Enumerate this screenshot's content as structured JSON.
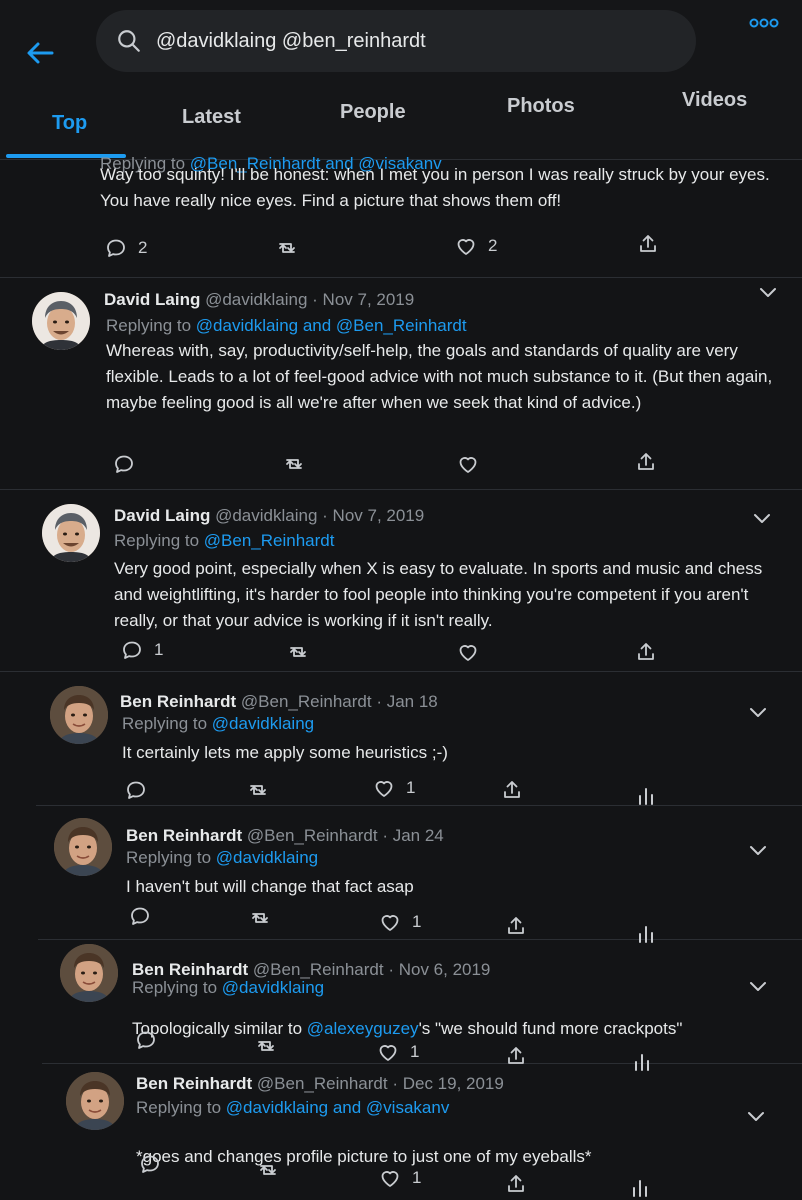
{
  "search": {
    "query": "@davidklaing @ben_reinhardt"
  },
  "tabs": [
    {
      "label": "Top"
    },
    {
      "label": "Latest"
    },
    {
      "label": "People"
    },
    {
      "label": "Photos"
    },
    {
      "label": "Videos"
    }
  ],
  "tweets": [
    {
      "name": "",
      "handle": "",
      "date": "",
      "reply_prefix": "Replying to",
      "reply_to": "@Ben_Reinhardt and @visakanv",
      "text": "Way too squinty! I'll be honest: when I met you in person I was really struck by your eyes. You have really nice eyes. Find a picture that shows them off!",
      "replies": "2",
      "retweets": "",
      "likes": "2"
    },
    {
      "name": "David Laing",
      "handle": "@davidklaing",
      "date": "· Nov 7, 2019",
      "reply_prefix": "Replying to",
      "reply_to": "@davidklaing and @Ben_Reinhardt",
      "text": "Whereas with, say, productivity/self-help, the goals and standards of quality are very flexible. Leads to a lot of feel-good advice with not much substance to it. (But then again, maybe feeling good is all we're after when we seek that kind of advice.)",
      "replies": "",
      "retweets": "",
      "likes": ""
    },
    {
      "name": "David Laing",
      "handle": "@davidklaing",
      "date": "· Nov 7, 2019",
      "reply_prefix": "Replying to",
      "reply_to": "@Ben_Reinhardt",
      "text": "Very good point, especially when X is easy to evaluate. In sports and music and chess and weightlifting, it's harder to fool people into thinking you're competent if you aren't really, or that your advice is working if it isn't really.",
      "replies": "1",
      "retweets": "",
      "likes": ""
    },
    {
      "name": "Ben Reinhardt",
      "handle": "@Ben_Reinhardt",
      "date": "· Jan 18",
      "reply_prefix": "Replying to",
      "reply_to": "@davidklaing",
      "text": "It certainly lets me apply some heuristics ;-)",
      "replies": "",
      "retweets": "",
      "likes": "1"
    },
    {
      "name": "Ben Reinhardt",
      "handle": "@Ben_Reinhardt",
      "date": "· Jan 24",
      "reply_prefix": "Replying to",
      "reply_to": "@davidklaing",
      "text": "I haven't but will change that fact asap",
      "replies": "",
      "retweets": "",
      "likes": "1"
    },
    {
      "name": "Ben Reinhardt",
      "handle": "@Ben_Reinhardt",
      "date": "· Nov 6, 2019",
      "reply_prefix": "Replying to",
      "reply_to": "@davidklaing",
      "text_before": "Topologically similar to ",
      "text_mention": "@alexeyguzey",
      "text_after": "'s \"we should fund more crackpots\"",
      "replies": "",
      "retweets": "",
      "likes": "1"
    },
    {
      "name": "Ben Reinhardt",
      "handle": "@Ben_Reinhardt",
      "date": "· Dec 19, 2019",
      "reply_prefix": "Replying to",
      "reply_to": "@davidklaing and @visakanv",
      "text": "*goes and changes profile picture to just one of my eyeballs*",
      "replies": "",
      "retweets": "",
      "likes": "1"
    }
  ],
  "colors": {
    "accent": "#1d9bf0",
    "background": "#131416",
    "divider": "#2b2e33",
    "muted": "#8b9096"
  }
}
